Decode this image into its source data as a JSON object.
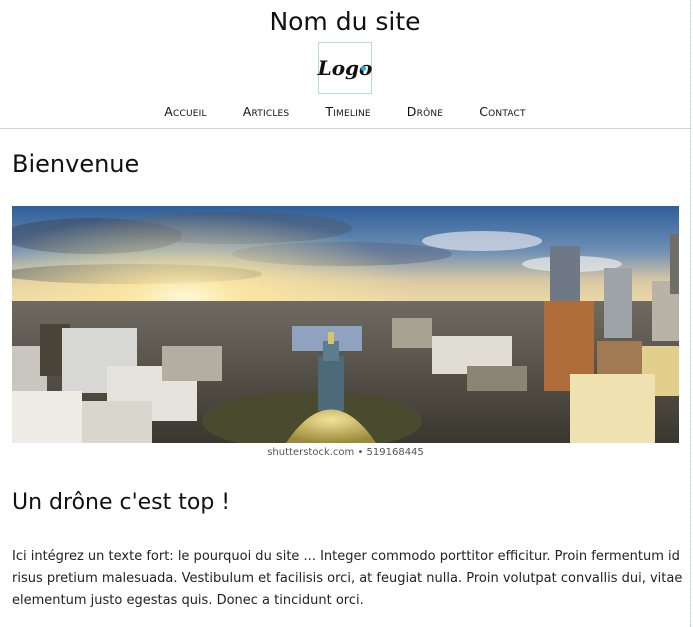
{
  "header": {
    "site_title": "Nom du site",
    "logo_text": "Logo"
  },
  "nav": {
    "items": [
      "Accueil",
      "Articles",
      "Timeline",
      "Drône",
      "Contact"
    ]
  },
  "main": {
    "heading": "Bienvenue",
    "image_credit": "shutterstock.com • 519168445",
    "section_heading": "Un drône c'est top !",
    "paragraph": "Ici intégrez un texte fort: le pourquoi du site ... Integer commodo porttitor efficitur. Proin fermentum id risus pretium malesuada. Vestibulum et facilisis orci, at feugiat nulla. Proin volutpat convallis dui, vitae elementum justo egestas quis. Donec a tincidunt orci."
  },
  "colors": {
    "logo_accent": "#18b6d6",
    "rule": "#d4d4d4"
  }
}
